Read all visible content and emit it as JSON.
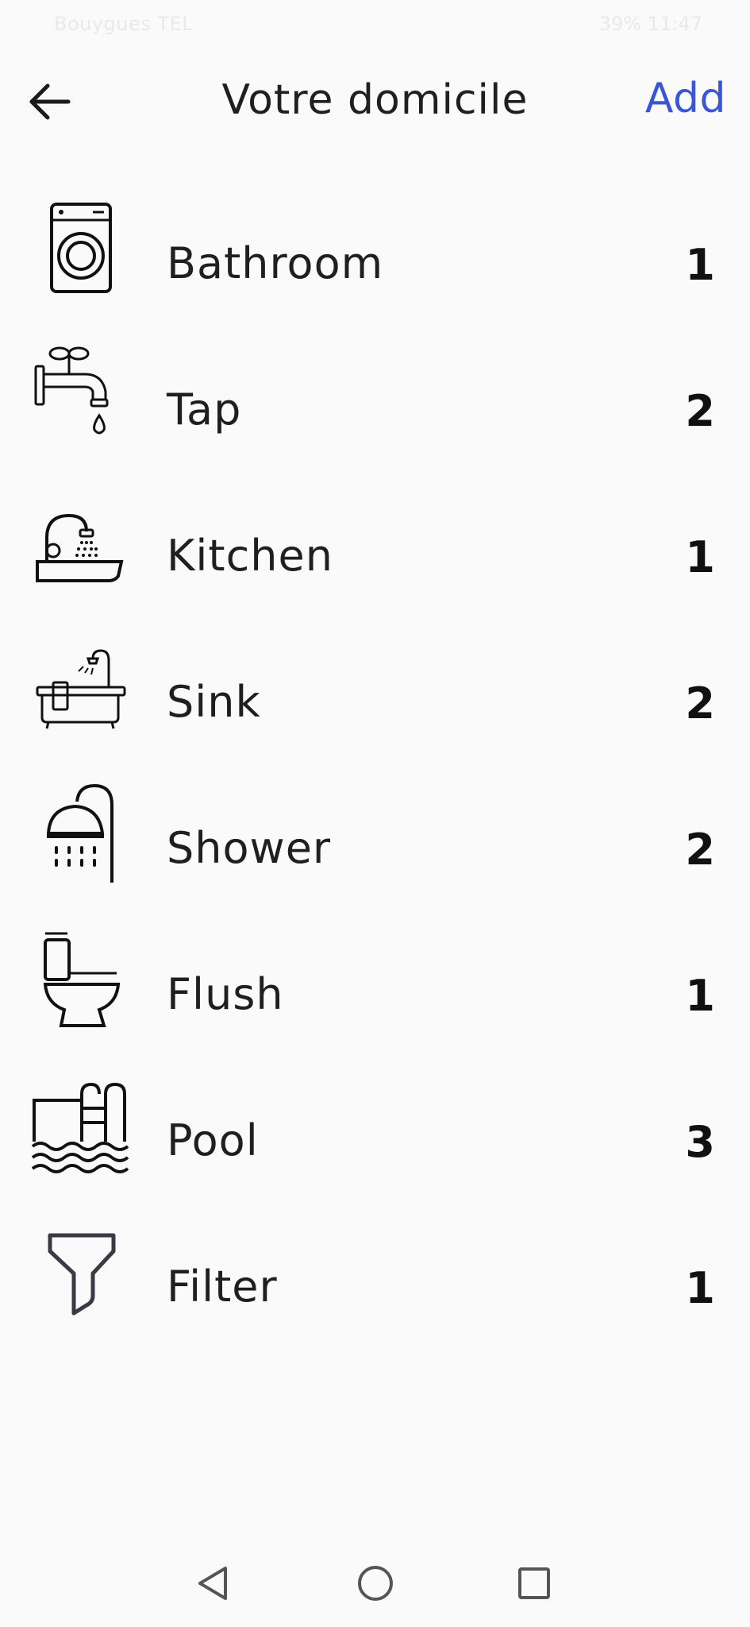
{
  "status_bar": {
    "carrier": "Bouygues TEL",
    "right": "39% 11:47"
  },
  "header": {
    "title": "Votre domicile",
    "add_label": "Add",
    "back_icon": "arrow-left-icon"
  },
  "items": [
    {
      "label": "Bathroom",
      "count": "1",
      "icon": "washing-machine-icon"
    },
    {
      "label": "Tap",
      "count": "2",
      "icon": "faucet-icon"
    },
    {
      "label": "Kitchen",
      "count": "1",
      "icon": "kitchen-sink-icon"
    },
    {
      "label": "Sink",
      "count": "2",
      "icon": "bathtub-icon"
    },
    {
      "label": "Shower",
      "count": "2",
      "icon": "shower-icon"
    },
    {
      "label": "Flush",
      "count": "1",
      "icon": "toilet-icon"
    },
    {
      "label": "Pool",
      "count": "3",
      "icon": "pool-icon"
    },
    {
      "label": "Filter",
      "count": "1",
      "icon": "funnel-icon"
    }
  ],
  "colors": {
    "accent": "#3a56d6",
    "background": "#fafafa",
    "text": "#1f1f1f"
  },
  "navbar": {
    "icons": [
      "nav-back-icon",
      "nav-home-icon",
      "nav-recent-icon"
    ]
  }
}
